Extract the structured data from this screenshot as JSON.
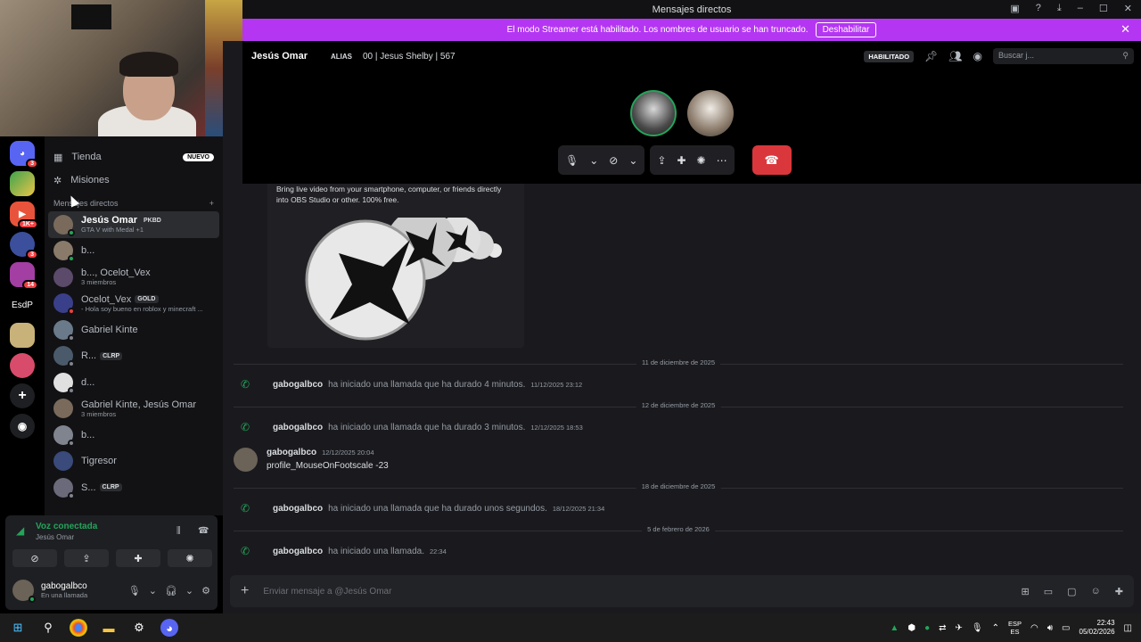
{
  "window": {
    "title": "Mensajes directos"
  },
  "streamer_banner": {
    "text": "El modo Streamer está habilitado. Los nombres de usuario se han truncado.",
    "button": "Deshabilitar"
  },
  "server_badges": {
    "s1": "3",
    "s3": "1K+",
    "s4": "3",
    "s5": "14",
    "s6": "EsdP"
  },
  "nav": {
    "tienda": "Tienda",
    "nuevo": "NUEVO",
    "misiones": "Misiones"
  },
  "dm_header": {
    "title": "Mensajes directos",
    "add": "+"
  },
  "dms": [
    {
      "name": "Jesús Omar",
      "tag": "PKBD",
      "sub": "GTA V with Medal +1"
    },
    {
      "name": "b...",
      "tag": "",
      "sub": ""
    },
    {
      "name": "b..., Ocelot_Vex",
      "tag": "",
      "sub": "3 miembros"
    },
    {
      "name": "Ocelot_Vex",
      "tag": "GOLD",
      "sub": "- Hola soy bueno en roblox y minecraft ..."
    },
    {
      "name": "Gabriel Kinte",
      "tag": "",
      "sub": ""
    },
    {
      "name": "R...",
      "tag": "CLRP",
      "sub": ""
    },
    {
      "name": "d...",
      "tag": "",
      "sub": ""
    },
    {
      "name": "Gabriel Kinte, Jesús Omar",
      "tag": "",
      "sub": "3 miembros"
    },
    {
      "name": "b...",
      "tag": "",
      "sub": ""
    },
    {
      "name": "Tigresor",
      "tag": "",
      "sub": ""
    },
    {
      "name": "S...",
      "tag": "CLRP",
      "sub": ""
    }
  ],
  "voice": {
    "status": "Voz conectada",
    "channel": "Jesús Omar"
  },
  "user": {
    "name": "gabogalbco",
    "status": "En una llamada"
  },
  "channel": {
    "name": "Jesús Omar",
    "alias_label": "ALIAS",
    "alias": "00 | Jesus Shelby | 567",
    "habilitado": "HABILITADO",
    "search_placeholder": "Buscar j..."
  },
  "embed": {
    "text": "Bring live video from your smartphone, computer, or friends directly into OBS Studio or other. 100% free."
  },
  "dividers": {
    "d1": "11 de diciembre de 2025",
    "d2": "12 de diciembre de 2025",
    "d3": "18 de diciembre de 2025",
    "d4": "5 de febrero de 2026"
  },
  "system_messages": [
    {
      "user": "gabogalbco",
      "text": "ha iniciado una llamada que ha durado 4 minutos.",
      "time": "11/12/2025 23:12"
    },
    {
      "user": "gabogalbco",
      "text": "ha iniciado una llamada que ha durado 3 minutos.",
      "time": "12/12/2025 18:53"
    },
    {
      "user": "gabogalbco",
      "text": "ha iniciado una llamada que ha durado unos segundos.",
      "time": "18/12/2025 21:34"
    },
    {
      "user": "gabogalbco",
      "text": "ha iniciado una llamada.",
      "time": "22:34"
    }
  ],
  "message": {
    "user": "gabogalbco",
    "time": "12/12/2025 20:04",
    "text": "profile_MouseOnFootscale -23"
  },
  "composer": {
    "placeholder": "Enviar mensaje a @Jesús Omar"
  },
  "taskbar": {
    "lang1": "ESP",
    "lang2": "ES",
    "time": "22:43",
    "date": "05/02/2026"
  },
  "colors": {
    "accent": "#b436f2",
    "online": "#23a55a",
    "danger": "#da373c"
  }
}
